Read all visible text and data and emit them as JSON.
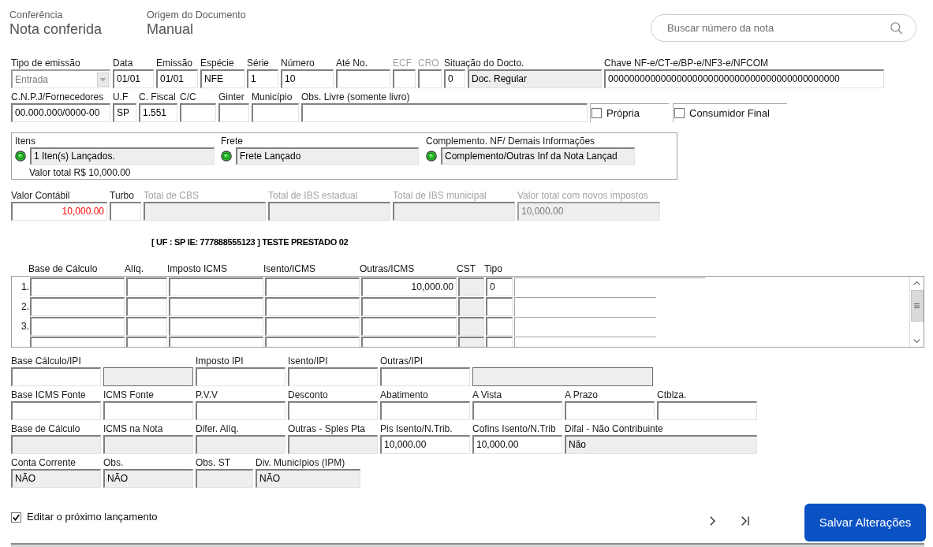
{
  "header": [
    {
      "label": "Conferência",
      "value": "Nota conferida"
    },
    {
      "label": "Origem do Documento",
      "value": "Manual"
    }
  ],
  "search": {
    "placeholder": "Buscar número da nota"
  },
  "document_rows": [
    [
      {
        "kind": "select",
        "label": "Tipo de emissão",
        "label_disabled": false,
        "value": "Entrada",
        "readonly": false,
        "disabled": true
      },
      {
        "kind": "text",
        "label": "Data",
        "label_disabled": false,
        "value": "01/01",
        "readonly": false,
        "disabled": false
      },
      {
        "kind": "text",
        "label": "Emissão",
        "label_disabled": false,
        "value": "01/01",
        "readonly": false,
        "disabled": false
      },
      {
        "kind": "text",
        "label": "Espécie",
        "label_disabled": false,
        "value": "NFE",
        "readonly": false,
        "disabled": false
      },
      {
        "kind": "text",
        "label": "Série",
        "label_disabled": false,
        "value": "1",
        "readonly": false,
        "disabled": false
      },
      {
        "kind": "text",
        "label": "Número",
        "label_disabled": false,
        "value": "10",
        "readonly": false,
        "disabled": false
      },
      {
        "kind": "text",
        "label": "Até No.",
        "label_disabled": false,
        "readonly": false,
        "disabled": false
      },
      {
        "kind": "text",
        "label": "ECF",
        "label_disabled": true,
        "readonly": false,
        "disabled": false
      },
      {
        "kind": "text",
        "label": "CRO",
        "label_disabled": true,
        "readonly": false,
        "disabled": false
      },
      {
        "kind": "text",
        "label": "Situação do Docto.",
        "label_disabled": false,
        "value": "0",
        "readonly": false,
        "disabled": false
      },
      {
        "kind": "text",
        "value": "Doc. Regular",
        "readonly": true,
        "disabled": false
      },
      {
        "kind": "text",
        "label": "Chave NF-e/CT-e/BP-e/NF3-e/NFCOM",
        "label_disabled": false,
        "value": "00000000000000000000000000000000000000000000",
        "readonly": false,
        "disabled": false
      }
    ],
    [
      {
        "kind": "text",
        "label": "C.N.P.J/Fornecedores",
        "label_disabled": false,
        "value": "00.000.000/0000-00",
        "readonly": false,
        "disabled": false
      },
      {
        "kind": "text",
        "label": "U.F",
        "label_disabled": false,
        "value": "SP",
        "readonly": false,
        "disabled": false
      },
      {
        "kind": "text",
        "label": "C. Fiscal",
        "label_disabled": false,
        "value": "1.551",
        "readonly": false,
        "disabled": false
      },
      {
        "kind": "text",
        "label": "C/C",
        "label_disabled": false,
        "readonly": false,
        "disabled": false
      },
      {
        "kind": "text",
        "label": "Ginter",
        "label_disabled": false,
        "readonly": false,
        "disabled": false
      },
      {
        "kind": "text",
        "label": "Município",
        "label_disabled": false,
        "readonly": false,
        "disabled": false
      },
      {
        "kind": "text",
        "label": "Obs. Livre (somente livro)",
        "label_disabled": false,
        "readonly": false,
        "disabled": false
      },
      {
        "kind": "checkbox",
        "label": "Própria",
        "checked": false
      },
      {
        "kind": "checkbox",
        "label": "Consumidor Final",
        "checked": false
      }
    ]
  ],
  "status_panel": {
    "items": [
      {
        "label": "Itens",
        "on": true,
        "value": "1 Iten(s) Lançados.",
        "readonly": true
      },
      {
        "label": "Frete",
        "on": true,
        "value": "Frete Lançado",
        "readonly": true
      },
      {
        "label": "Complemento. NF/ Demais Informações",
        "on": true,
        "value": "Complemento/Outras Inf da Nota Lançad",
        "readonly": true
      }
    ],
    "total": "Valor total R$ 10,000.00"
  },
  "totals_row": [
    {
      "kind": "amount",
      "label": "Valor Contábil",
      "label_disabled": false,
      "value": "10,000.00",
      "color": "#ff0000",
      "readonly": false,
      "disabled": false
    },
    {
      "kind": "text",
      "label": "Turbo",
      "label_disabled": false,
      "readonly": false,
      "disabled": false
    },
    {
      "kind": "text",
      "label": "Total de CBS",
      "label_disabled": true,
      "readonly": true,
      "disabled": false
    },
    {
      "kind": "text",
      "label": "Total de IBS estadual",
      "label_disabled": true,
      "readonly": true,
      "disabled": false
    },
    {
      "kind": "text",
      "label": "Total de IBS municipal",
      "label_disabled": true,
      "readonly": true,
      "disabled": false
    },
    {
      "kind": "text",
      "label": "Valor total com novos impostos",
      "label_disabled": true,
      "value": "10,000.00",
      "readonly": true,
      "disabled": true
    }
  ],
  "company_line": "[ UF : SP IE: 777888555123 ] TESTE PRESTADO 02",
  "icms_grid": {
    "columns": [
      {
        "label": "Base de Cálculo",
        "kind": "amount",
        "readonly": false
      },
      {
        "label": "Alíq.",
        "kind": "amount",
        "readonly": false
      },
      {
        "label": "Imposto ICMS",
        "kind": "amount",
        "readonly": false
      },
      {
        "label": "Isento/ICMS",
        "kind": "amount",
        "readonly": false
      },
      {
        "label": "Outras/ICMS",
        "kind": "amount",
        "readonly": false
      },
      {
        "label": "CST",
        "kind": "text",
        "readonly": true
      },
      {
        "label": "Tipo",
        "kind": "text",
        "readonly": false
      },
      {
        "kind": "memo",
        "readonly": false
      }
    ],
    "rows": [
      {
        "number": "1.",
        "cells": [
          {},
          {},
          {},
          {},
          {
            "value": "10,000.00"
          },
          {},
          {
            "value": "0"
          },
          {}
        ]
      },
      {
        "number": "2.",
        "cells": [
          {},
          {},
          {},
          {},
          {},
          {},
          {},
          {}
        ]
      },
      {
        "number": "3.",
        "cells": [
          {},
          {},
          {},
          {},
          {},
          {},
          {},
          {}
        ]
      },
      {
        "cells": [
          {},
          {},
          {},
          {},
          {},
          {},
          {},
          {}
        ]
      }
    ]
  },
  "tax_rows": [
    [
      {
        "kind": "text",
        "label": "Base Cálculo/IPI",
        "label_disabled": false,
        "readonly": false,
        "disabled": false
      },
      {
        "kind": "display",
        "readonly": true,
        "disabled": false
      },
      {
        "kind": "text",
        "label": "Imposto IPI",
        "label_disabled": false,
        "readonly": false,
        "disabled": false
      },
      {
        "kind": "text",
        "label": "Isento/IPI",
        "label_disabled": false,
        "readonly": false,
        "disabled": false
      },
      {
        "kind": "text",
        "label": "Outras/IPI",
        "label_disabled": false,
        "readonly": false,
        "disabled": false
      },
      {
        "kind": "display",
        "readonly": true,
        "disabled": false
      }
    ],
    [
      {
        "kind": "text",
        "label": "Base ICMS Fonte",
        "label_disabled": false,
        "readonly": false,
        "disabled": false
      },
      {
        "kind": "text",
        "label": "ICMS Fonte",
        "label_disabled": false,
        "readonly": false,
        "disabled": false
      },
      {
        "kind": "text",
        "label": "P.V.V",
        "label_disabled": false,
        "readonly": false,
        "disabled": false
      },
      {
        "kind": "text",
        "label": "Desconto",
        "label_disabled": false,
        "readonly": false,
        "disabled": false
      },
      {
        "kind": "text",
        "label": "Abatimento",
        "label_disabled": false,
        "readonly": false,
        "disabled": false
      },
      {
        "kind": "text",
        "label": "A Vista",
        "label_disabled": false,
        "readonly": false,
        "disabled": false
      },
      {
        "kind": "text",
        "label": "A Prazo",
        "label_disabled": false,
        "readonly": false,
        "disabled": false
      },
      {
        "kind": "text",
        "label": "Ctblza.",
        "label_disabled": false,
        "readonly": false,
        "disabled": false
      }
    ],
    [
      {
        "kind": "text",
        "label": "Base de Cálculo",
        "label_disabled": false,
        "readonly": true,
        "disabled": false
      },
      {
        "kind": "text",
        "label": "ICMS na Nota",
        "label_disabled": false,
        "readonly": true,
        "disabled": false
      },
      {
        "kind": "text",
        "label": "Difer. Alíq.",
        "label_disabled": false,
        "readonly": true,
        "disabled": false
      },
      {
        "kind": "text",
        "label": "Outras - Sples Pta",
        "label_disabled": false,
        "readonly": true,
        "disabled": false
      },
      {
        "kind": "text",
        "label": "Pis Isento/N.Trib.",
        "label_disabled": false,
        "value": "10,000.00",
        "readonly": false,
        "disabled": false
      },
      {
        "kind": "text",
        "label": "Cofins Isento/N.Trib",
        "label_disabled": false,
        "value": "10,000.00",
        "readonly": false,
        "disabled": false
      },
      {
        "kind": "text",
        "label": "Difal - Não Contribuinte",
        "label_disabled": false,
        "value": "Não",
        "readonly": true,
        "disabled": false
      }
    ],
    [
      {
        "kind": "text",
        "label": "Conta Corrente",
        "label_disabled": false,
        "value": "NÃO",
        "readonly": true,
        "disabled": false
      },
      {
        "kind": "text",
        "label": "Obs.",
        "label_disabled": false,
        "value": "NÃO",
        "readonly": true,
        "disabled": false
      },
      {
        "kind": "text",
        "label": "Obs. ST",
        "label_disabled": false,
        "readonly": true,
        "disabled": false
      },
      {
        "kind": "text",
        "label": "Div. Municípios (IPM)",
        "label_disabled": false,
        "value": "NÃO",
        "readonly": true,
        "disabled": false
      }
    ]
  ],
  "edit_next": {
    "label": "Editar o próximo lançamento",
    "checked": true
  },
  "save_button": {
    "label": "Salvar Alterações"
  }
}
